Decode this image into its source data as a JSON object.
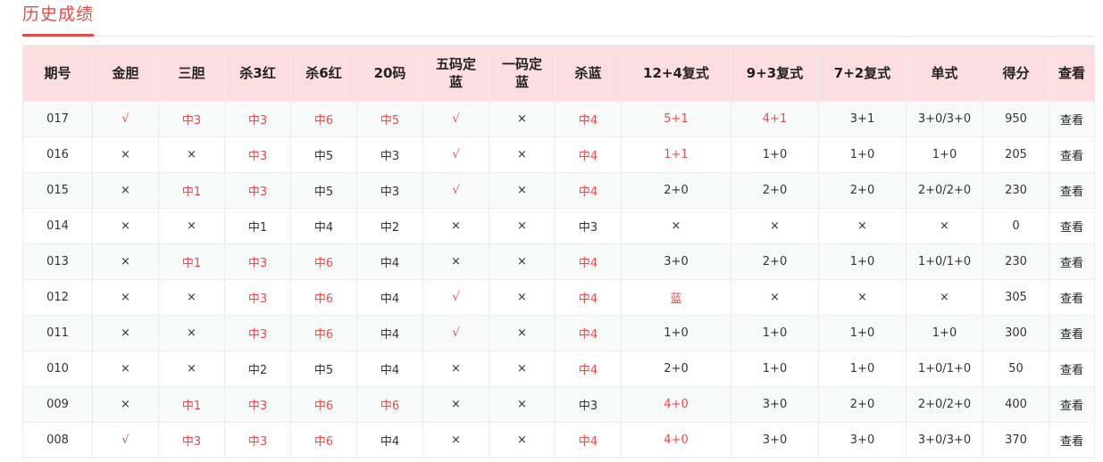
{
  "section": {
    "title": "历史成绩"
  },
  "colors": {
    "accent": "#e84a4a",
    "header_bg": "#fcdde0",
    "hit_text": "#e84a4a"
  },
  "table": {
    "headers": [
      {
        "key": "period",
        "lines": [
          "期号"
        ]
      },
      {
        "key": "jindan",
        "lines": [
          "金胆"
        ]
      },
      {
        "key": "sandan",
        "lines": [
          "三胆"
        ]
      },
      {
        "key": "sha3hong",
        "lines": [
          "杀3红"
        ]
      },
      {
        "key": "sha6hong",
        "lines": [
          "杀6红"
        ]
      },
      {
        "key": "ma20",
        "lines": [
          "20码"
        ]
      },
      {
        "key": "wumadinglan",
        "lines": [
          "五码定",
          "蓝"
        ]
      },
      {
        "key": "yimadinglan",
        "lines": [
          "一码定",
          "蓝"
        ]
      },
      {
        "key": "shalan",
        "lines": [
          "杀蓝"
        ]
      },
      {
        "key": "fushi12_4",
        "lines": [
          "12+4复式"
        ]
      },
      {
        "key": "fushi9_3",
        "lines": [
          "9+3复式"
        ]
      },
      {
        "key": "fushi7_2",
        "lines": [
          "7+2复式"
        ]
      },
      {
        "key": "danshi",
        "lines": [
          "单式"
        ]
      },
      {
        "key": "score",
        "lines": [
          "得分"
        ]
      },
      {
        "key": "view",
        "lines": [
          "查看"
        ]
      }
    ],
    "rows": [
      {
        "cells": [
          {
            "text": "017",
            "hit": false
          },
          {
            "text": "√",
            "hit": true
          },
          {
            "text": "中3",
            "hit": true
          },
          {
            "text": "中3",
            "hit": true
          },
          {
            "text": "中6",
            "hit": true
          },
          {
            "text": "中5",
            "hit": true
          },
          {
            "text": "√",
            "hit": true
          },
          {
            "text": "×",
            "hit": false
          },
          {
            "text": "中4",
            "hit": true
          },
          {
            "text": "5+1",
            "hit": true
          },
          {
            "text": "4+1",
            "hit": true
          },
          {
            "text": "3+1",
            "hit": false
          },
          {
            "text": "3+0/3+0",
            "hit": false
          },
          {
            "text": "950",
            "hit": false
          },
          {
            "text": "查看",
            "hit": false,
            "link": true
          }
        ]
      },
      {
        "cells": [
          {
            "text": "016",
            "hit": false
          },
          {
            "text": "×",
            "hit": false
          },
          {
            "text": "×",
            "hit": false
          },
          {
            "text": "中3",
            "hit": true
          },
          {
            "text": "中5",
            "hit": false
          },
          {
            "text": "中3",
            "hit": false
          },
          {
            "text": "√",
            "hit": true
          },
          {
            "text": "×",
            "hit": false
          },
          {
            "text": "中4",
            "hit": true
          },
          {
            "text": "1+1",
            "hit": true
          },
          {
            "text": "1+0",
            "hit": false
          },
          {
            "text": "1+0",
            "hit": false
          },
          {
            "text": "1+0",
            "hit": false
          },
          {
            "text": "205",
            "hit": false
          },
          {
            "text": "查看",
            "hit": false,
            "link": true
          }
        ]
      },
      {
        "cells": [
          {
            "text": "015",
            "hit": false
          },
          {
            "text": "×",
            "hit": false
          },
          {
            "text": "中1",
            "hit": true
          },
          {
            "text": "中3",
            "hit": true
          },
          {
            "text": "中5",
            "hit": false
          },
          {
            "text": "中3",
            "hit": false
          },
          {
            "text": "√",
            "hit": true
          },
          {
            "text": "×",
            "hit": false
          },
          {
            "text": "中4",
            "hit": true
          },
          {
            "text": "2+0",
            "hit": false
          },
          {
            "text": "2+0",
            "hit": false
          },
          {
            "text": "2+0",
            "hit": false
          },
          {
            "text": "2+0/2+0",
            "hit": false
          },
          {
            "text": "230",
            "hit": false
          },
          {
            "text": "查看",
            "hit": false,
            "link": true
          }
        ]
      },
      {
        "cells": [
          {
            "text": "014",
            "hit": false
          },
          {
            "text": "×",
            "hit": false
          },
          {
            "text": "×",
            "hit": false
          },
          {
            "text": "中1",
            "hit": false
          },
          {
            "text": "中4",
            "hit": false
          },
          {
            "text": "中2",
            "hit": false
          },
          {
            "text": "×",
            "hit": false
          },
          {
            "text": "×",
            "hit": false
          },
          {
            "text": "中3",
            "hit": false
          },
          {
            "text": "×",
            "hit": false
          },
          {
            "text": "×",
            "hit": false
          },
          {
            "text": "×",
            "hit": false
          },
          {
            "text": "×",
            "hit": false
          },
          {
            "text": "0",
            "hit": false
          },
          {
            "text": "查看",
            "hit": false,
            "link": true
          }
        ]
      },
      {
        "cells": [
          {
            "text": "013",
            "hit": false
          },
          {
            "text": "×",
            "hit": false
          },
          {
            "text": "中1",
            "hit": true
          },
          {
            "text": "中3",
            "hit": true
          },
          {
            "text": "中6",
            "hit": true
          },
          {
            "text": "中4",
            "hit": false
          },
          {
            "text": "×",
            "hit": false
          },
          {
            "text": "×",
            "hit": false
          },
          {
            "text": "中4",
            "hit": true
          },
          {
            "text": "3+0",
            "hit": false
          },
          {
            "text": "2+0",
            "hit": false
          },
          {
            "text": "1+0",
            "hit": false
          },
          {
            "text": "1+0/1+0",
            "hit": false
          },
          {
            "text": "230",
            "hit": false
          },
          {
            "text": "查看",
            "hit": false,
            "link": true
          }
        ]
      },
      {
        "cells": [
          {
            "text": "012",
            "hit": false
          },
          {
            "text": "×",
            "hit": false
          },
          {
            "text": "×",
            "hit": false
          },
          {
            "text": "中3",
            "hit": true
          },
          {
            "text": "中6",
            "hit": true
          },
          {
            "text": "中4",
            "hit": false
          },
          {
            "text": "√",
            "hit": true
          },
          {
            "text": "×",
            "hit": false
          },
          {
            "text": "中4",
            "hit": true
          },
          {
            "text": "蓝",
            "hit": true
          },
          {
            "text": "×",
            "hit": false
          },
          {
            "text": "×",
            "hit": false
          },
          {
            "text": "×",
            "hit": false
          },
          {
            "text": "305",
            "hit": false
          },
          {
            "text": "查看",
            "hit": false,
            "link": true
          }
        ]
      },
      {
        "cells": [
          {
            "text": "011",
            "hit": false
          },
          {
            "text": "×",
            "hit": false
          },
          {
            "text": "×",
            "hit": false
          },
          {
            "text": "中3",
            "hit": true
          },
          {
            "text": "中6",
            "hit": true
          },
          {
            "text": "中4",
            "hit": false
          },
          {
            "text": "√",
            "hit": true
          },
          {
            "text": "×",
            "hit": false
          },
          {
            "text": "中4",
            "hit": true
          },
          {
            "text": "1+0",
            "hit": false
          },
          {
            "text": "1+0",
            "hit": false
          },
          {
            "text": "1+0",
            "hit": false
          },
          {
            "text": "1+0",
            "hit": false
          },
          {
            "text": "300",
            "hit": false
          },
          {
            "text": "查看",
            "hit": false,
            "link": true
          }
        ]
      },
      {
        "cells": [
          {
            "text": "010",
            "hit": false
          },
          {
            "text": "×",
            "hit": false
          },
          {
            "text": "×",
            "hit": false
          },
          {
            "text": "中2",
            "hit": false
          },
          {
            "text": "中5",
            "hit": false
          },
          {
            "text": "中4",
            "hit": false
          },
          {
            "text": "×",
            "hit": false
          },
          {
            "text": "×",
            "hit": false
          },
          {
            "text": "中4",
            "hit": true
          },
          {
            "text": "2+0",
            "hit": false
          },
          {
            "text": "1+0",
            "hit": false
          },
          {
            "text": "1+0",
            "hit": false
          },
          {
            "text": "1+0/1+0",
            "hit": false
          },
          {
            "text": "50",
            "hit": false
          },
          {
            "text": "查看",
            "hit": false,
            "link": true
          }
        ]
      },
      {
        "cells": [
          {
            "text": "009",
            "hit": false
          },
          {
            "text": "×",
            "hit": false
          },
          {
            "text": "中1",
            "hit": true
          },
          {
            "text": "中3",
            "hit": true
          },
          {
            "text": "中6",
            "hit": true
          },
          {
            "text": "中6",
            "hit": true
          },
          {
            "text": "×",
            "hit": false
          },
          {
            "text": "×",
            "hit": false
          },
          {
            "text": "中3",
            "hit": false
          },
          {
            "text": "4+0",
            "hit": true
          },
          {
            "text": "3+0",
            "hit": false
          },
          {
            "text": "2+0",
            "hit": false
          },
          {
            "text": "2+0/2+0",
            "hit": false
          },
          {
            "text": "400",
            "hit": false
          },
          {
            "text": "查看",
            "hit": false,
            "link": true
          }
        ]
      },
      {
        "cells": [
          {
            "text": "008",
            "hit": false
          },
          {
            "text": "√",
            "hit": true
          },
          {
            "text": "中3",
            "hit": true
          },
          {
            "text": "中3",
            "hit": true
          },
          {
            "text": "中6",
            "hit": true
          },
          {
            "text": "中4",
            "hit": false
          },
          {
            "text": "×",
            "hit": false
          },
          {
            "text": "×",
            "hit": false
          },
          {
            "text": "中4",
            "hit": true
          },
          {
            "text": "4+0",
            "hit": true
          },
          {
            "text": "3+0",
            "hit": false
          },
          {
            "text": "3+0",
            "hit": false
          },
          {
            "text": "3+0/3+0",
            "hit": false
          },
          {
            "text": "370",
            "hit": false
          },
          {
            "text": "查看",
            "hit": false,
            "link": true
          }
        ]
      }
    ]
  }
}
